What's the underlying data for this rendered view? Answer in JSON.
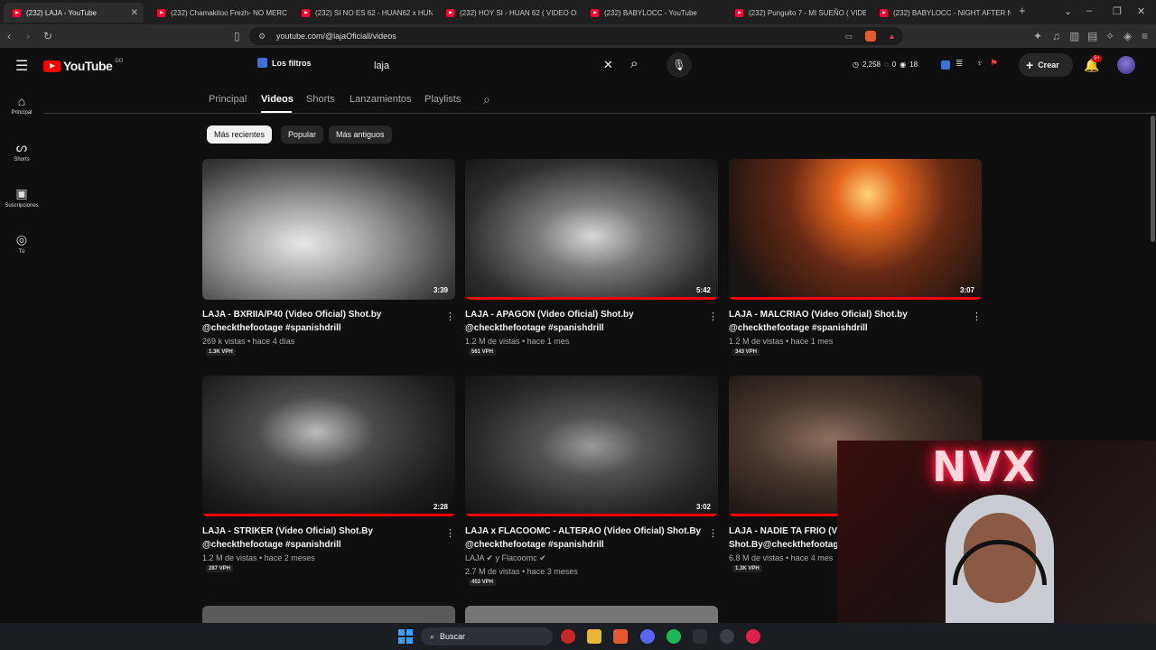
{
  "browser": {
    "tabs": [
      {
        "title": "(232) LAJA - YouTube",
        "active": true
      },
      {
        "title": "(232) Chamakitoo Frezh- NO MERC"
      },
      {
        "title": "(232) SI NO ES 62 - HUAN62 x HUN"
      },
      {
        "title": "(232) HOY SI - HUAN 62 ( VIDEO OF"
      },
      {
        "title": "(232) BABYLOCC - YouTube"
      },
      {
        "title": "(232) Punguito 7 - MI SUEÑO ( VIDE"
      },
      {
        "title": "(232) BABYLOCC - NIGHT AFTER NI"
      }
    ],
    "url": "youtube.com/@lajaOficiall/videos"
  },
  "youtube": {
    "logo_text": "YouTube",
    "logo_region": "DO",
    "filters_label": "Los filtros",
    "search_value": "laja",
    "stats": {
      "views": "2,258",
      "zero": "0",
      "eighteen": "18"
    },
    "create_label": "Crear",
    "notif_badge": "9+"
  },
  "rail": [
    {
      "label": "Principal",
      "icon": "home-icon"
    },
    {
      "label": "Shorts",
      "icon": "shorts-icon"
    },
    {
      "label": "Suscripciones",
      "icon": "subscriptions-icon"
    },
    {
      "label": "Tú",
      "icon": "you-icon"
    }
  ],
  "channel_tabs": [
    "Principal",
    "Videos",
    "Shorts",
    "Lanzamientos",
    "Playlists"
  ],
  "chips": [
    "Más recientes",
    "Popular",
    "Más antiguos"
  ],
  "videos": [
    {
      "title1": "LAJA - BXRIIA/P40 (Video Oficial) Shot.by",
      "title2": "@checkthefootage #spanishdrill",
      "meta": "269 k vistas • hace 4 días",
      "vph": "1.3K VPH",
      "duration": "3:39",
      "progress": 0,
      "tone": "light"
    },
    {
      "title1": "LAJA - APAGON (Video Oficial) Shot.by",
      "title2": "@checkthefootage #spanishdrill",
      "meta": "1.2 M de vistas • hace 1 mes",
      "vph": "561 VPH",
      "duration": "5:42",
      "progress": 1,
      "tone": "gray"
    },
    {
      "title1": "LAJA - MALCRIAO (Video Oficial) Shot.by",
      "title2": "@checkthefootage #spanishdrill",
      "meta": "1.2 M de vistas • hace 1 mes",
      "vph": "343 VPH",
      "duration": "3:07",
      "progress": 1,
      "tone": "fire"
    },
    {
      "title1": "LAJA - STRIKER (Video Oficial) Shot.By",
      "title2": "@checkthefootage #spanishdrill",
      "meta": "1.2 M de vistas • hace 2 meses",
      "vph": "287 VPH",
      "duration": "2:28",
      "progress": 1,
      "tone": "dark"
    },
    {
      "title1": "LAJA x FLACOOMC - ALTERAO (Video Oficial) Shot.By",
      "title2": "@checkthefootage #spanishdrill",
      "meta_channels": "LAJA ✔ y Flacoomc ✔",
      "meta": "2.7 M de vistas • hace 3 meses",
      "vph": "453 VPH",
      "duration": "3:02",
      "progress": 1,
      "tone": "crowd"
    },
    {
      "title1": "LAJA - NADIE TA FRIO (V",
      "title2": "Shot.By@checkthefootag",
      "meta": "6.8 M de vistas • hace 4 mes",
      "vph": "1.3K VPH",
      "duration": "",
      "progress": 1,
      "tone": "warm"
    }
  ],
  "taskbar": {
    "search_label": "Buscar"
  },
  "overlay": {
    "neon_text": "NVX"
  },
  "colors": {
    "accent": "#ff0000",
    "background": "#0f0f0f"
  }
}
